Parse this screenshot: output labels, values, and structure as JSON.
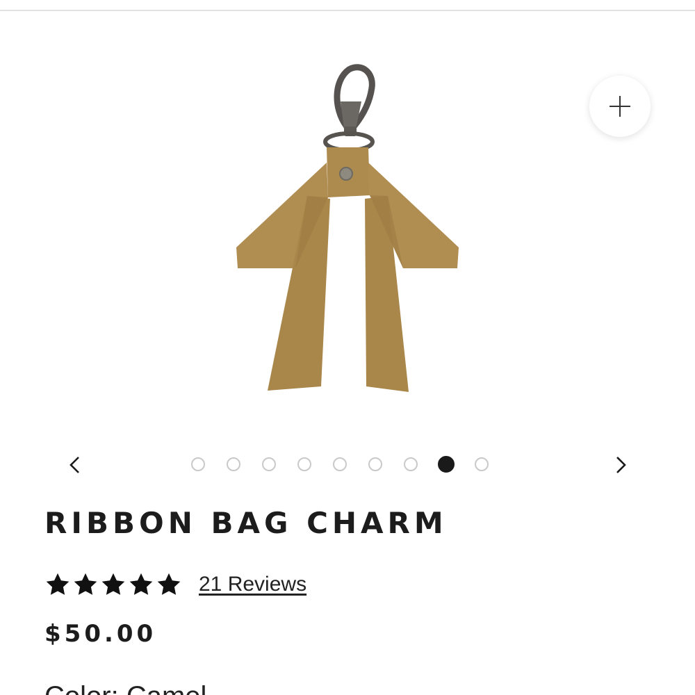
{
  "gallery": {
    "image_alt": "Ribbon bag charm",
    "total_images": 9,
    "active_index": 8,
    "zoom_icon": "plus-icon",
    "prev_icon": "chevron-left-icon",
    "next_icon": "chevron-right-icon"
  },
  "product": {
    "title": "RIBBON BAG CHARM",
    "rating": 5,
    "rating_max": 5,
    "reviews_label": "21 Reviews",
    "price": "$50.00",
    "color_label": "Color: Camel"
  },
  "colors": {
    "leather": "#b08d50",
    "text": "#1c1c1c",
    "dot_inactive": "#c9c9c9",
    "dot_active": "#1a1a1a"
  }
}
